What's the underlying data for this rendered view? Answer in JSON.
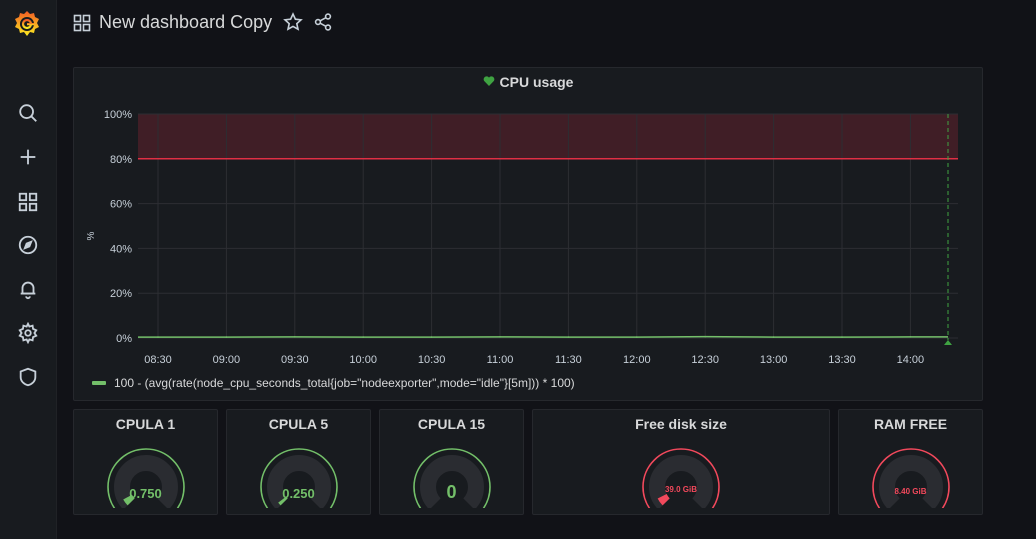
{
  "header": {
    "title": "New dashboard Copy",
    "grid_icon": "apps-icon",
    "star_icon": "star-icon",
    "share_icon": "share-icon"
  },
  "sidebar": {
    "logo": "grafana-logo",
    "items": [
      {
        "name": "search-icon"
      },
      {
        "name": "plus-icon"
      },
      {
        "name": "dashboards-icon"
      },
      {
        "name": "compass-icon"
      },
      {
        "name": "bell-icon"
      },
      {
        "name": "gear-icon"
      },
      {
        "name": "shield-icon"
      }
    ]
  },
  "cpu_panel": {
    "title": "CPU usage",
    "status_icon": "heart-icon",
    "status_color": "#3fa342"
  },
  "chart_data": {
    "type": "line",
    "title": "CPU usage",
    "ylabel": "%",
    "yticks": [
      "0%",
      "20%",
      "40%",
      "60%",
      "80%",
      "100%"
    ],
    "ylim": [
      0,
      100
    ],
    "x_ticks": [
      "08:30",
      "09:00",
      "09:30",
      "10:00",
      "10:30",
      "11:00",
      "11:30",
      "12:00",
      "12:30",
      "13:00",
      "13:30",
      "14:00"
    ],
    "threshold": {
      "value": 80,
      "color": "#e02f44"
    },
    "grid": true,
    "legend_position": "bottom-left",
    "series": [
      {
        "name": "100 - (avg(rate(node_cpu_seconds_total{job=\"nodeexporter\",mode=\"idle\"}[5m])) * 100)",
        "color": "#73bf69",
        "values": [
          0.4,
          0.4,
          0.5,
          0.4,
          0.4,
          0.5,
          0.4,
          0.4,
          0.6,
          0.4,
          0.4,
          0.5
        ]
      }
    ],
    "annotation_color": "#3fa342"
  },
  "gauges": [
    {
      "title": "CPULA 1",
      "value": "0.750",
      "fraction": 0.06,
      "color": "#73bf69"
    },
    {
      "title": "CPULA 5",
      "value": "0.250",
      "fraction": 0.03,
      "color": "#73bf69"
    },
    {
      "title": "CPULA 15",
      "value": "0",
      "fraction": 0.0,
      "color": "#73bf69"
    },
    {
      "title": "Free disk size",
      "value": "39.0 GiB",
      "fraction": 0.07,
      "color": "#f2495c"
    },
    {
      "title": "RAM FREE",
      "value": "8.40 GiB",
      "fraction": 0.0,
      "color": "#f2495c"
    }
  ]
}
